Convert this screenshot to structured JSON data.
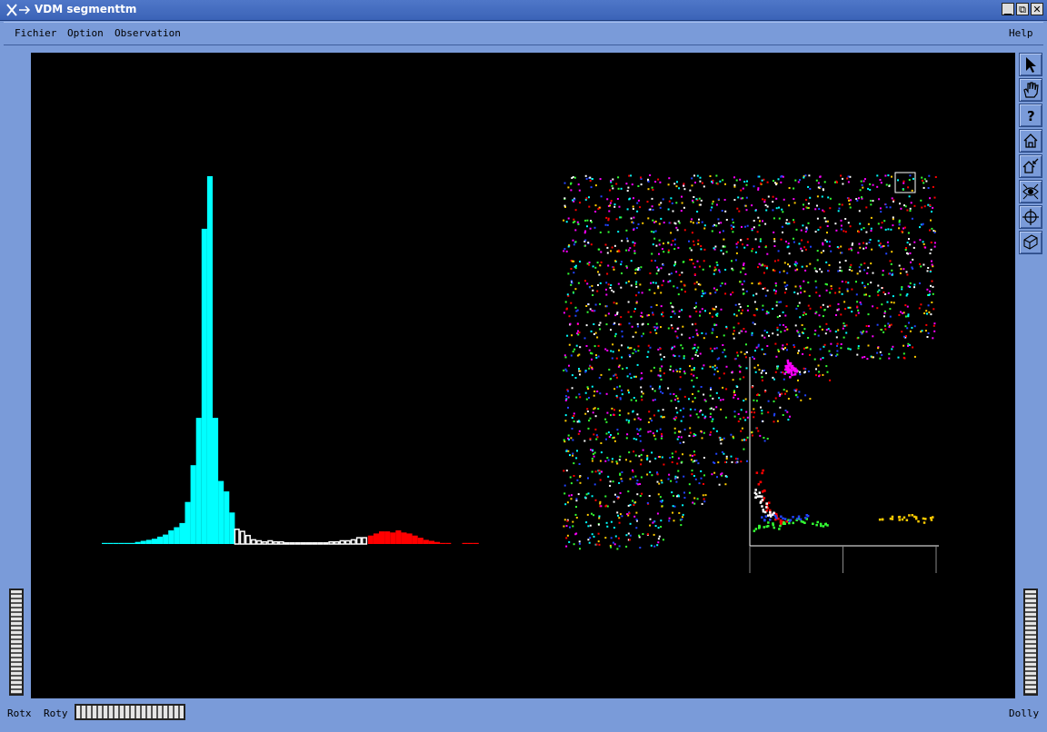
{
  "window": {
    "title": "VDM segmenttm",
    "controls": [
      "minimize-icon",
      "maximize-icon",
      "close-icon"
    ]
  },
  "menubar": {
    "items": [
      "Fichier",
      "Option",
      "Observation"
    ],
    "help": "Help"
  },
  "toolbar": {
    "tools": [
      "pick-arrow-icon",
      "hand-icon",
      "question-icon",
      "home-icon",
      "set-home-icon",
      "view-all-icon",
      "seek-icon",
      "projection-icon"
    ]
  },
  "bottombar": {
    "rotx": "Rotx",
    "roty": "Roty",
    "dolly": "Dolly"
  },
  "colors": {
    "background": "#000000",
    "cyan": "#00ffff",
    "white": "#ffffff",
    "red": "#ff0000",
    "magenta": "#ff00ff",
    "green": "#33ff33",
    "yellow": "#ffcc00",
    "blue": "#2244ff"
  },
  "chart_data": [
    {
      "type": "bar",
      "series": [
        {
          "name": "",
          "color": "#00ffff",
          "values": [
            1,
            1,
            1,
            1,
            1,
            1,
            2,
            3,
            4,
            5,
            7,
            9,
            13,
            16,
            20,
            40,
            75,
            120,
            300,
            350,
            120,
            60,
            50,
            30
          ]
        },
        {
          "name": "",
          "color": "#ffffff",
          "values": [
            14,
            12,
            8,
            4,
            3,
            2,
            3,
            2,
            2,
            1,
            1,
            1,
            1,
            1,
            1,
            1,
            1,
            2,
            2,
            3,
            3,
            4,
            6,
            6
          ]
        },
        {
          "name": "",
          "color": "#ff0000",
          "values": [
            8,
            10,
            12,
            12,
            11,
            13,
            11,
            10,
            8,
            6,
            4,
            3,
            2,
            1,
            1,
            0,
            0,
            1,
            1,
            1
          ]
        }
      ]
    },
    {
      "type": "scatter",
      "series": [
        {
          "name": "",
          "color": "#ff00ff",
          "x": [
            20,
            21,
            22,
            20,
            23,
            21,
            19,
            22,
            24,
            20,
            21,
            23,
            22,
            20
          ],
          "y": [
            95,
            96,
            94,
            97,
            95,
            93,
            96,
            98,
            94,
            92,
            97,
            95,
            96,
            99
          ]
        },
        {
          "name": "",
          "color": "#ff0000",
          "x": [
            5,
            6,
            7,
            8,
            9,
            10,
            12,
            14,
            16,
            18
          ],
          "y": [
            40,
            35,
            30,
            25,
            22,
            20,
            18,
            15,
            14,
            13
          ]
        },
        {
          "name": "",
          "color": "#33ff33",
          "x": [
            3,
            5,
            8,
            10,
            14,
            18,
            22,
            26,
            30,
            34,
            38,
            40
          ],
          "y": [
            10,
            11,
            12,
            12,
            11,
            12,
            13,
            14,
            14,
            13,
            12,
            11
          ]
        },
        {
          "name": "",
          "color": "#2244ff",
          "x": [
            6,
            10,
            14,
            18,
            22,
            26,
            30
          ],
          "y": [
            15,
            16,
            17,
            16,
            15,
            16,
            17
          ]
        },
        {
          "name": "",
          "color": "#ffcc00",
          "x": [
            70,
            74,
            78,
            82,
            86,
            90,
            94,
            98
          ],
          "y": [
            14,
            15,
            16,
            15,
            16,
            15,
            14,
            15
          ]
        },
        {
          "name": "",
          "color": "#ffffff",
          "x": [
            3,
            4,
            5,
            6,
            7,
            8,
            10,
            12
          ],
          "y": [
            30,
            28,
            26,
            24,
            22,
            20,
            18,
            17
          ]
        }
      ]
    }
  ]
}
